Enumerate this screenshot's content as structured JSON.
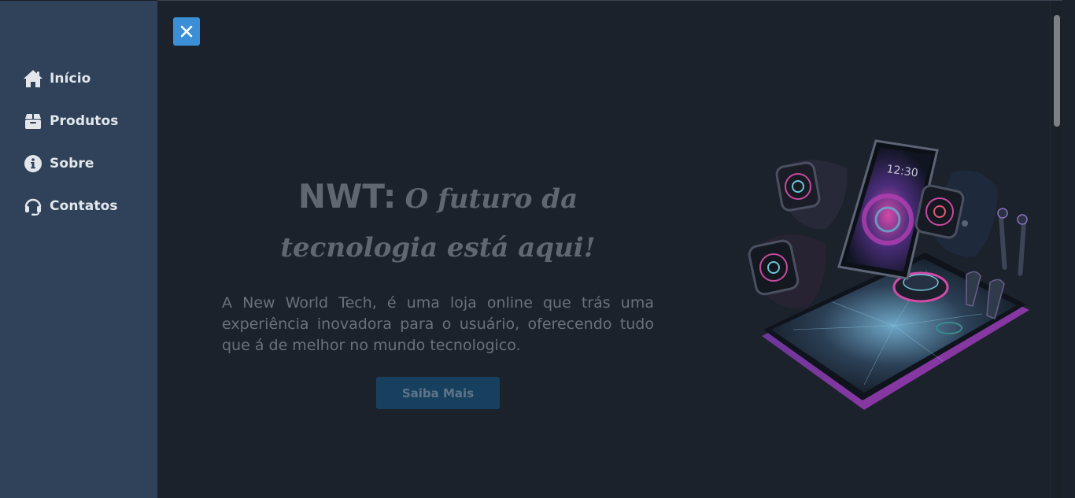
{
  "sidebar": {
    "items": [
      {
        "label": "Início",
        "icon": "home-icon"
      },
      {
        "label": "Produtos",
        "icon": "box-icon"
      },
      {
        "label": "Sobre",
        "icon": "info-icon"
      },
      {
        "label": "Contatos",
        "icon": "headset-icon"
      }
    ]
  },
  "toolbar": {
    "close_icon": "close-icon"
  },
  "hero": {
    "brand": "NWT:",
    "tagline": "O futuro da tecnologia está aqui!",
    "description": "A New World Tech, é uma loja online que trás uma experiência inovadora para o usuário, oferecendo tudo que á de melhor no mundo tecnologico.",
    "button_label": "Saiba Mais",
    "image_subject": "smartwatches, smartphone, earbuds and tablet illustration"
  },
  "colors": {
    "sidebar_bg": "#2f4259",
    "main_bg": "#1c222b",
    "close_button": "#3a8fd6",
    "cta_button": "#17405f",
    "heading_text": "#5f6770"
  }
}
